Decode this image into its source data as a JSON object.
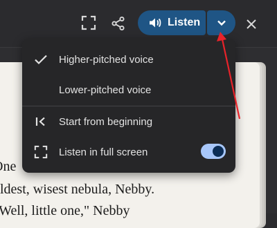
{
  "toolbar": {
    "fullscreen_icon": "fullscreen-icon",
    "share_icon": "share-icon",
    "listen_label": "Listen",
    "listen_icon": "speaker-icon",
    "dropdown_icon": "chevron-down-icon",
    "close_icon": "close-icon",
    "accent_color": "#1f5585"
  },
  "menu": {
    "items": [
      {
        "label": "Higher-pitched voice",
        "icon": "check-icon",
        "selected": true
      },
      {
        "label": "Lower-pitched voice",
        "icon": "",
        "selected": false
      },
      {
        "label": "Start from beginning",
        "icon": "skip-to-start-icon"
      },
      {
        "label": "Listen in full screen",
        "icon": "fullscreen-icon",
        "toggle_on": true
      }
    ]
  },
  "book": {
    "lines": [
      "One",
      "oldest, wisest nebula, Nebby.",
      "\"Well, little one,\" Nebby"
    ]
  },
  "annotation": {
    "arrow_color": "#e8232a"
  }
}
